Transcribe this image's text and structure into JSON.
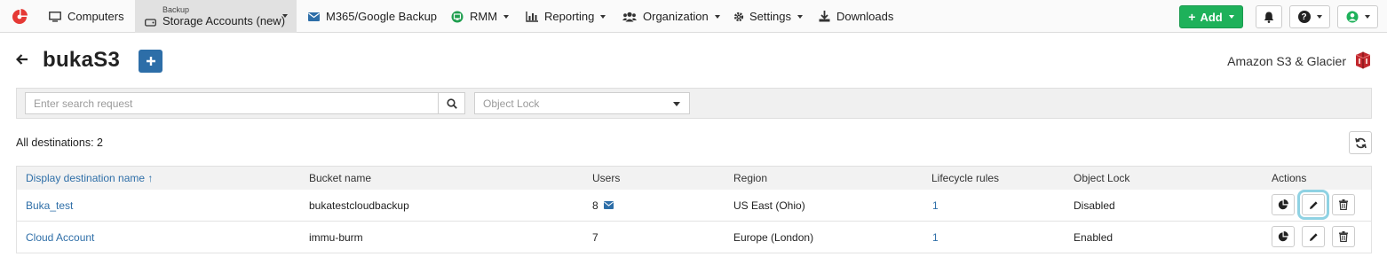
{
  "nav": {
    "computers": "Computers",
    "backup_small": "Backup",
    "backup_big": "Storage Accounts (new)",
    "m365": "M365/Google Backup",
    "rmm": "RMM",
    "reporting": "Reporting",
    "organization": "Organization",
    "settings": "Settings",
    "downloads": "Downloads",
    "add": "Add",
    "help": "?"
  },
  "icons": {
    "logo": "pie-logo",
    "computers": "monitor-icon",
    "backup": "hdd-icon",
    "m365": "envelope-icon",
    "rmm": "rmm-icon",
    "reporting": "bar-chart-icon",
    "organization": "users-icon",
    "settings": "gear-icon",
    "downloads": "download-icon",
    "bell": "bell-icon",
    "user": "user-circle-icon"
  },
  "colors": {
    "accent": "#2d6ea8",
    "link": "#2f6fa8",
    "add_green": "#1eb15a",
    "highlight": "#8fd2e3",
    "logo_red": "#e53935"
  },
  "header": {
    "title": "bukaS3",
    "provider": "Amazon S3 & Glacier"
  },
  "filters": {
    "search_placeholder": "Enter search request",
    "object_lock_placeholder": "Object Lock"
  },
  "count_label": "All destinations: 2",
  "table": {
    "columns": [
      "Display destination name ↑",
      "Bucket name",
      "Users",
      "Region",
      "Lifecycle rules",
      "Object Lock",
      "Actions"
    ],
    "rows": [
      {
        "name": "Buka_test",
        "bucket": "bukatestcloudbackup",
        "users": "8",
        "region": "US East (Ohio)",
        "lifecycle": "1",
        "object_lock": "Disabled"
      },
      {
        "name": "Cloud Account",
        "bucket": "immu-burm",
        "users": "7",
        "region": "Europe (London)",
        "lifecycle": "1",
        "object_lock": "Enabled"
      }
    ]
  }
}
